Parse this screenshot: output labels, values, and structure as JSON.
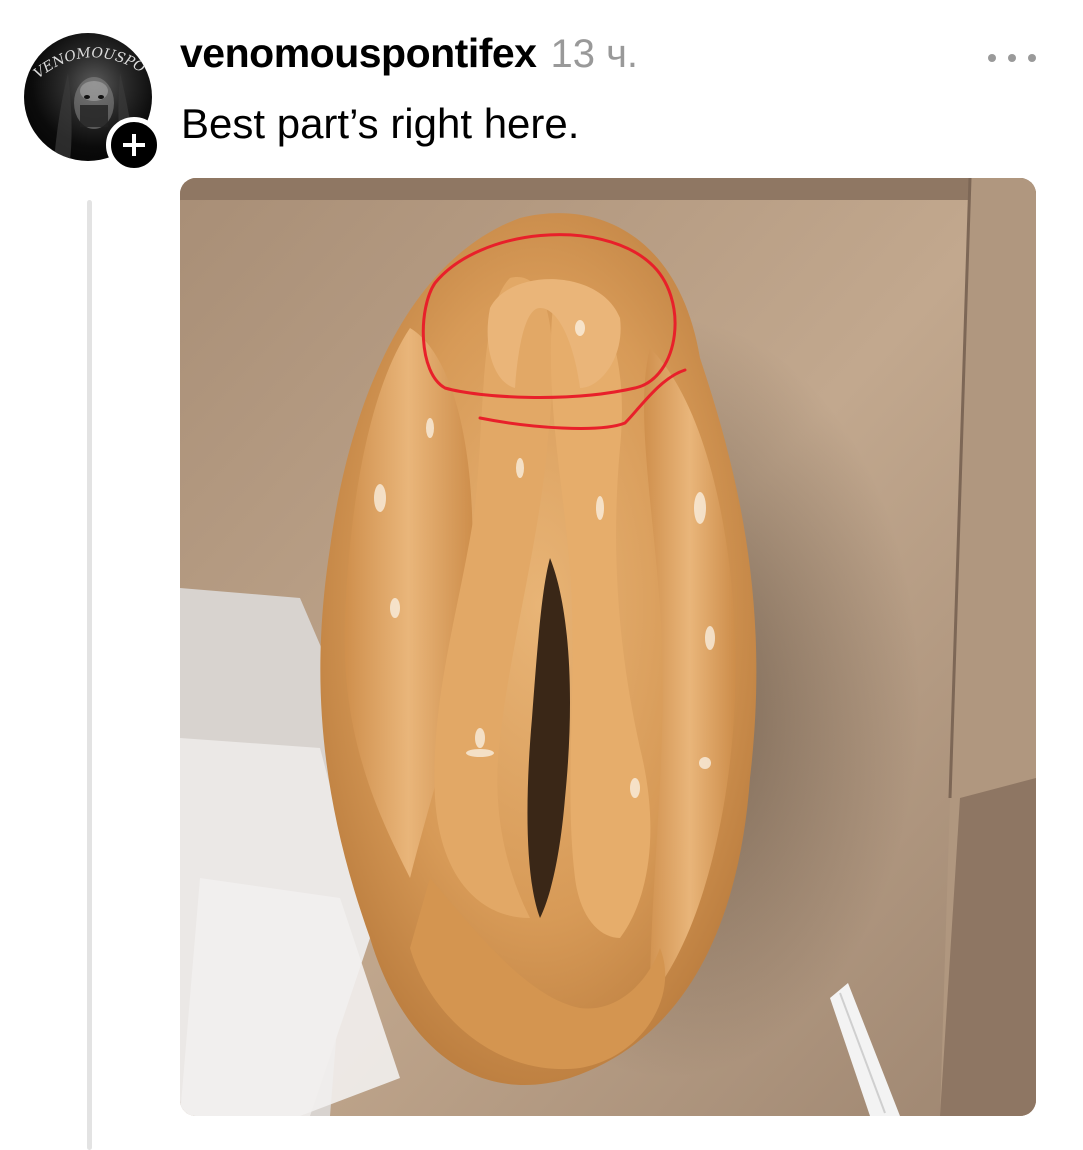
{
  "post": {
    "username": "venomouspontifex",
    "timestamp": "13 ч.",
    "text": "Best part’s right here.",
    "avatar_text": "VENOMOUSPONTIFEX",
    "follow_symbol": "+",
    "more_icon": "more-horizontal-icon"
  },
  "photo": {
    "subject": "glazed pastry in cardboard box",
    "annotation_color": "#e8202a"
  },
  "colors": {
    "username": "#000000",
    "timestamp": "#999999",
    "thread_line": "#e3e3e3",
    "box": "#b89d83"
  }
}
